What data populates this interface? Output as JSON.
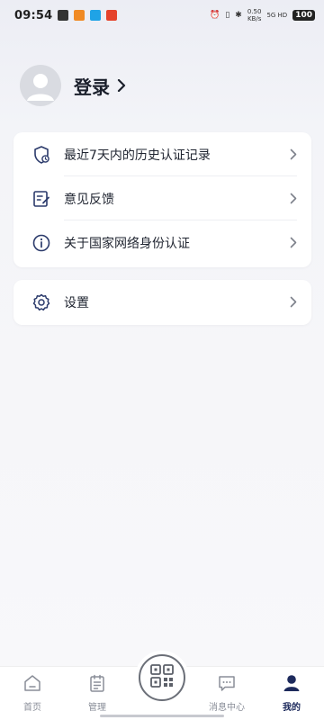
{
  "status_bar": {
    "time": "09:54",
    "speed_value": "0.50",
    "speed_unit": "KB/s",
    "signal": "5G HD",
    "battery": "100"
  },
  "profile": {
    "login_label": "登录"
  },
  "menu_group_1": [
    {
      "label": "最近7天内的历史认证记录",
      "icon": "shield-check-icon"
    },
    {
      "label": "意见反馈",
      "icon": "edit-note-icon"
    },
    {
      "label": "关于国家网络身份认证",
      "icon": "info-icon"
    }
  ],
  "menu_group_2": [
    {
      "label": "设置",
      "icon": "gear-icon"
    }
  ],
  "bottom_nav": {
    "items": [
      {
        "label": "首页",
        "icon": "home-icon"
      },
      {
        "label": "管理",
        "icon": "clipboard-icon"
      },
      {
        "label": "消息中心",
        "icon": "message-icon"
      },
      {
        "label": "我的",
        "icon": "person-icon",
        "active": true
      }
    ],
    "center": "qr-scan-icon"
  },
  "colors": {
    "accent": "#1d2a5c",
    "icon_dark": "#2b3a6b",
    "inactive": "#8a8e98"
  }
}
